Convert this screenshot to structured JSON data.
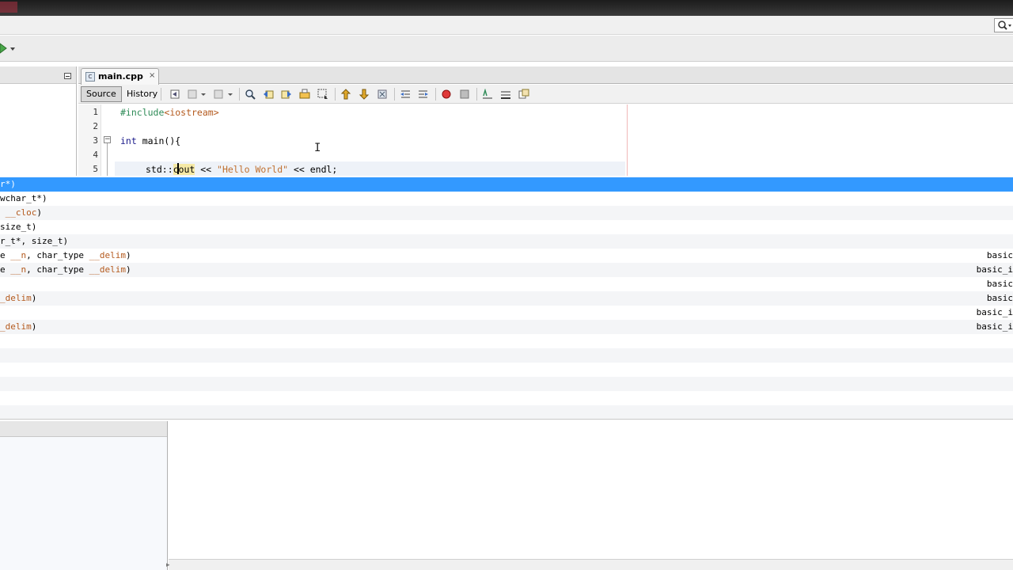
{
  "editor": {
    "tab_label": "main.cpp",
    "tab_close": "×",
    "source_label": "Source",
    "history_label": "History",
    "lines": [
      {
        "num": "1"
      },
      {
        "num": "2"
      },
      {
        "num": "3"
      },
      {
        "num": "4"
      },
      {
        "num": "5"
      }
    ],
    "code": {
      "l1_directive": "#include",
      "l1_header": "<iostream>",
      "l3_kw": "int",
      "l3_rest": " main(){",
      "l5_ns": "std::",
      "l5_id": "cout",
      "l5_op": " << ",
      "l5_str": "\"Hello World\"",
      "l5_end": " << endl;"
    }
  },
  "completion": {
    "rows": [
      {
        "left": "r*)",
        "right": ""
      },
      {
        "left": "wchar_t*)",
        "right": ""
      },
      {
        "left_pre": " ",
        "left_u": "__cloc",
        "left_post": ")",
        "right": ""
      },
      {
        "left": "size_t)",
        "right": ""
      },
      {
        "left": "r_t*, size_t)",
        "right": ""
      },
      {
        "left_pre": "e ",
        "left_u": "__n",
        "left_mid": ", char_type ",
        "left_u2": "__delim",
        "left_post": ")",
        "right": "basic"
      },
      {
        "left_pre": "e ",
        "left_u": "__n",
        "left_mid": ", char_type ",
        "left_u2": "__delim",
        "left_post": ")",
        "right": "basic_i"
      },
      {
        "left": "",
        "right": "basic"
      },
      {
        "left_pre": "",
        "left_u": "_delim",
        "left_post": ")",
        "right": "basic"
      },
      {
        "left": "",
        "right": "basic_i"
      },
      {
        "left_pre": "",
        "left_u": "_delim",
        "left_post": ")",
        "right": "basic_i"
      }
    ]
  },
  "colors": {
    "selection": "#3399ff",
    "string": "#c07030",
    "preprocessor": "#2e8b57"
  }
}
